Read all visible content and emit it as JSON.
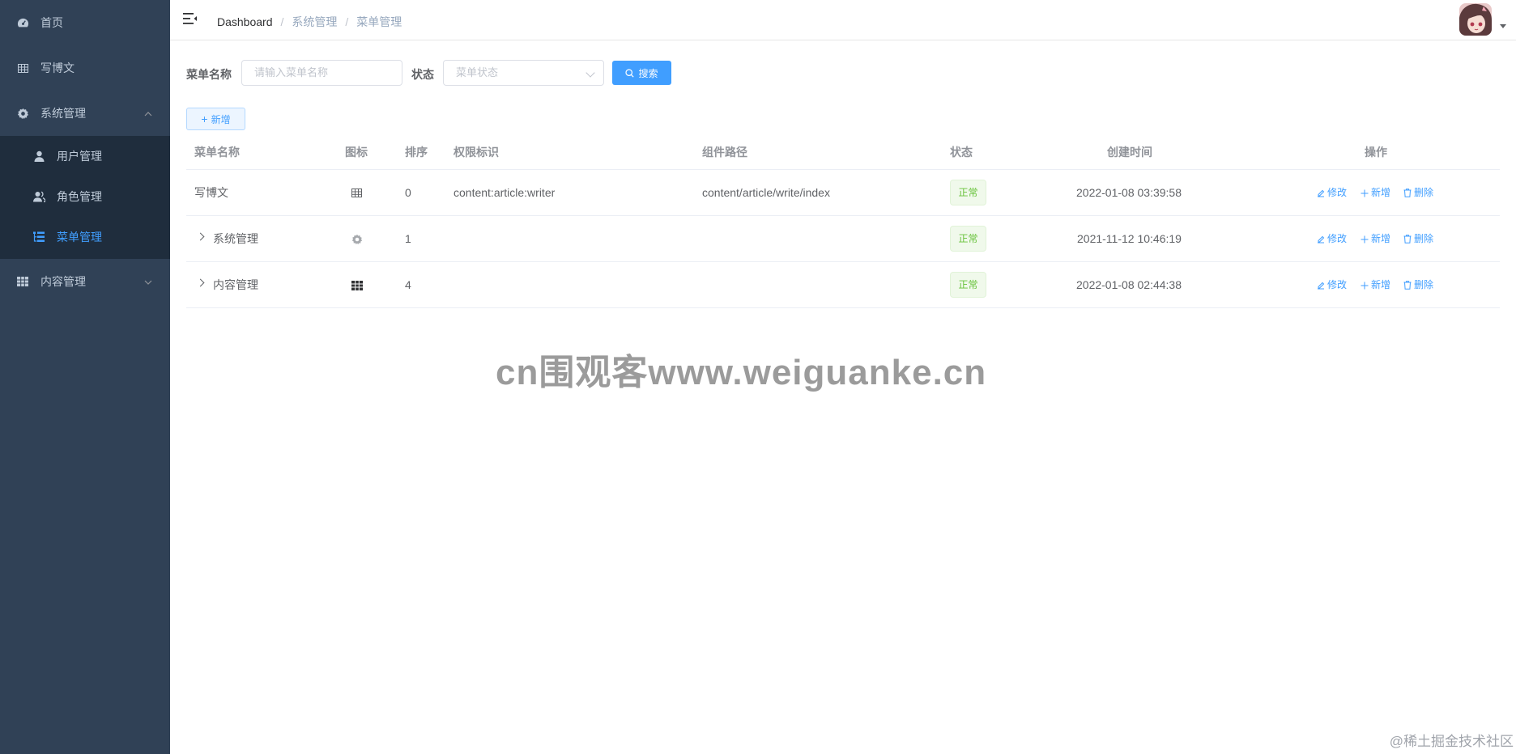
{
  "sidebar": {
    "items": [
      {
        "label": "首页",
        "icon": "dashboard-icon"
      },
      {
        "label": "写博文",
        "icon": "table-icon"
      },
      {
        "label": "系统管理",
        "icon": "gear-icon",
        "expanded": true
      },
      {
        "label": "内容管理",
        "icon": "grid-icon",
        "expanded": false
      }
    ],
    "submenu": [
      {
        "label": "用户管理",
        "icon": "user-icon"
      },
      {
        "label": "角色管理",
        "icon": "peoples-icon"
      },
      {
        "label": "菜单管理",
        "icon": "tree-table-icon",
        "active": true
      }
    ]
  },
  "navbar": {
    "breadcrumb": [
      "Dashboard",
      "系统管理",
      "菜单管理"
    ],
    "separator": "/"
  },
  "search": {
    "menu_name_label": "菜单名称",
    "menu_name_placeholder": "请输入菜单名称",
    "status_label": "状态",
    "status_placeholder": "菜单状态",
    "search_button": "搜索"
  },
  "toolbar": {
    "add_button": "新增"
  },
  "table": {
    "headers": [
      "菜单名称",
      "图标",
      "排序",
      "权限标识",
      "组件路径",
      "状态",
      "创建时间",
      "操作"
    ],
    "rows": [
      {
        "name": "写博文",
        "icon": "table-icon",
        "order": "0",
        "perms": "content:article:writer",
        "component": "content/article/write/index",
        "status": "正常",
        "created": "2022-01-08 03:39:58",
        "expandable": false
      },
      {
        "name": "系统管理",
        "icon": "gear-icon",
        "order": "1",
        "perms": "",
        "component": "",
        "status": "正常",
        "created": "2021-11-12 10:46:19",
        "expandable": true
      },
      {
        "name": "内容管理",
        "icon": "grid-icon",
        "order": "4",
        "perms": "",
        "component": "",
        "status": "正常",
        "created": "2022-01-08 02:44:38",
        "expandable": true
      }
    ],
    "actions": {
      "edit": "修改",
      "add": "新增",
      "delete": "删除"
    }
  },
  "watermark": "cn围观客www.weiguanke.cn",
  "footer_credit": "@稀土掘金技术社区",
  "colors": {
    "sidebar_bg": "#304156",
    "submenu_bg": "#1f2d3d",
    "primary": "#409eff",
    "success": "#67c23a"
  }
}
